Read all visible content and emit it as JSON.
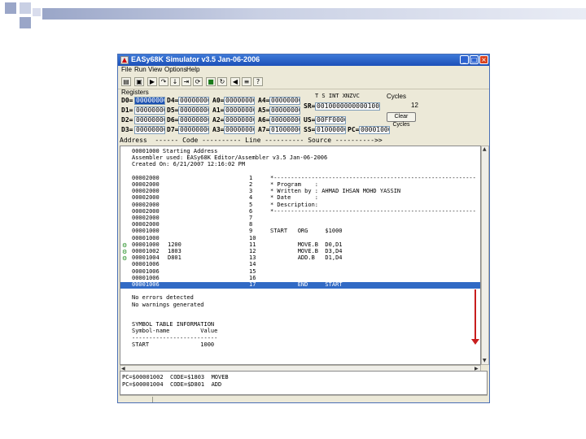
{
  "window": {
    "title": "EASy68K Simulator v3.5 Jan-06-2006",
    "app_icon": "easy68k-app-icon",
    "controls": {
      "minimize": "_",
      "maximize": "□",
      "close": "×"
    }
  },
  "menu": [
    "File",
    "Run",
    "View",
    "Options",
    "Help"
  ],
  "toolbar_icons": [
    "open-icon",
    "save-icon",
    "run-icon",
    "step-over-icon",
    "trace-into-icon",
    "run-to-cursor-icon",
    "auto-trace-icon",
    "stop-icon",
    "reload-icon",
    "rewind-icon",
    "log-icon",
    "help-icon"
  ],
  "registers_label": "Registers",
  "registers": [
    {
      "d_label": "D0=",
      "d_value": "00000000",
      "d2_label": "D4=",
      "d2_value": "00000000",
      "a_label": "A0=",
      "a_value": "00000000",
      "a2_label": "A4=",
      "a2_value": "00000000"
    },
    {
      "d_label": "D1=",
      "d_value": "00000000",
      "d2_label": "D5=",
      "d2_value": "00000000",
      "a_label": "A1=",
      "a_value": "00000000",
      "a2_label": "A5=",
      "a2_value": "00000000"
    },
    {
      "d_label": "D2=",
      "d_value": "00000000",
      "d2_label": "D6=",
      "d2_value": "00000000",
      "a_label": "A2=",
      "a_value": "00000000",
      "a2_label": "A6=",
      "a2_value": "00000000"
    },
    {
      "d_label": "D3=",
      "d_value": "00000000",
      "d2_label": "D7=",
      "d2_value": "00000000",
      "a_label": "A3=",
      "a_value": "00000000",
      "a2_label": "A7=",
      "a2_value": "01000000"
    }
  ],
  "sr": {
    "flags_header": "T S  INT  XNZVC",
    "label": "SR=",
    "value": "0010000000000100",
    "cycles_label": "Cycles",
    "cycles_value": "12",
    "clear_cycles": "Clear Cycles"
  },
  "us": {
    "label": "US=",
    "value": "00FF0000"
  },
  "ss": {
    "label": "SS=",
    "value": "01000000",
    "pc_label": "PC=",
    "pc_value": "00001000"
  },
  "columns_header": "Address  ------ Code ---------- Line ---------- Source ---------->>",
  "listing": [
    {
      "addr": "00001000",
      "code": "",
      "line": "",
      "src": "Starting Address",
      "bp": false,
      "hl": false,
      "full": "00001000 Starting Address"
    },
    {
      "full": "Assembler used: EASy68K Editor/Assembler v3.5 Jan-06-2006"
    },
    {
      "full": "Created On: 6/21/2007 12:16:02 PM"
    },
    {
      "full": ""
    },
    {
      "addr": "00002000",
      "code": "",
      "line": "1",
      "src": "*-----------------------------------------------------------"
    },
    {
      "addr": "00002000",
      "code": "",
      "line": "2",
      "src": "* Program    :"
    },
    {
      "addr": "00002000",
      "code": "",
      "line": "3",
      "src": "* Written by : AHMAD IHSAN MOHD YASSIN"
    },
    {
      "addr": "00002000",
      "code": "",
      "line": "4",
      "src": "* Date       :"
    },
    {
      "addr": "00002000",
      "code": "",
      "line": "5",
      "src": "* Description:"
    },
    {
      "addr": "00002000",
      "code": "",
      "line": "6",
      "src": "*-----------------------------------------------------------"
    },
    {
      "addr": "00002000",
      "code": "",
      "line": "7",
      "src": ""
    },
    {
      "addr": "00002000",
      "code": "",
      "line": "8",
      "src": ""
    },
    {
      "addr": "00001000",
      "code": "",
      "line": "9",
      "src": "START   ORG     $1000"
    },
    {
      "addr": "00001000",
      "code": "",
      "line": "10",
      "src": ""
    },
    {
      "addr": "00001000",
      "code": "1200",
      "line": "11",
      "src": "        MOVE.B  D0,D1",
      "bp": true
    },
    {
      "addr": "00001002",
      "code": "1803",
      "line": "12",
      "src": "        MOVE.B  D3,D4",
      "bp": true
    },
    {
      "addr": "00001004",
      "code": "D801",
      "line": "13",
      "src": "        ADD.B   D1,D4",
      "bp": true
    },
    {
      "addr": "00001006",
      "code": "",
      "line": "14",
      "src": ""
    },
    {
      "addr": "00001006",
      "code": "",
      "line": "15",
      "src": ""
    },
    {
      "addr": "00001006",
      "code": "",
      "line": "16",
      "src": ""
    },
    {
      "addr": "00001006",
      "code": "",
      "line": "17",
      "src": "        END     START",
      "hl": true
    },
    {
      "full": ""
    },
    {
      "full": "No errors detected"
    },
    {
      "full": "No warnings generated"
    },
    {
      "full": ""
    },
    {
      "full": ""
    },
    {
      "full": "SYMBOL TABLE INFORMATION"
    },
    {
      "full": "Symbol-name         Value"
    },
    {
      "full": "-------------------------"
    },
    {
      "full": "START               1000"
    }
  ],
  "output": [
    "PC=$00001002  CODE=$1803  MOVEB",
    "PC=$00001004  CODE=$D801  ADD"
  ],
  "colors": {
    "title_bar": "#1c4fb8",
    "highlight": "#316ac5",
    "annotation_arrow": "#c81e1e",
    "breakpoint": "#1a8a1a"
  }
}
